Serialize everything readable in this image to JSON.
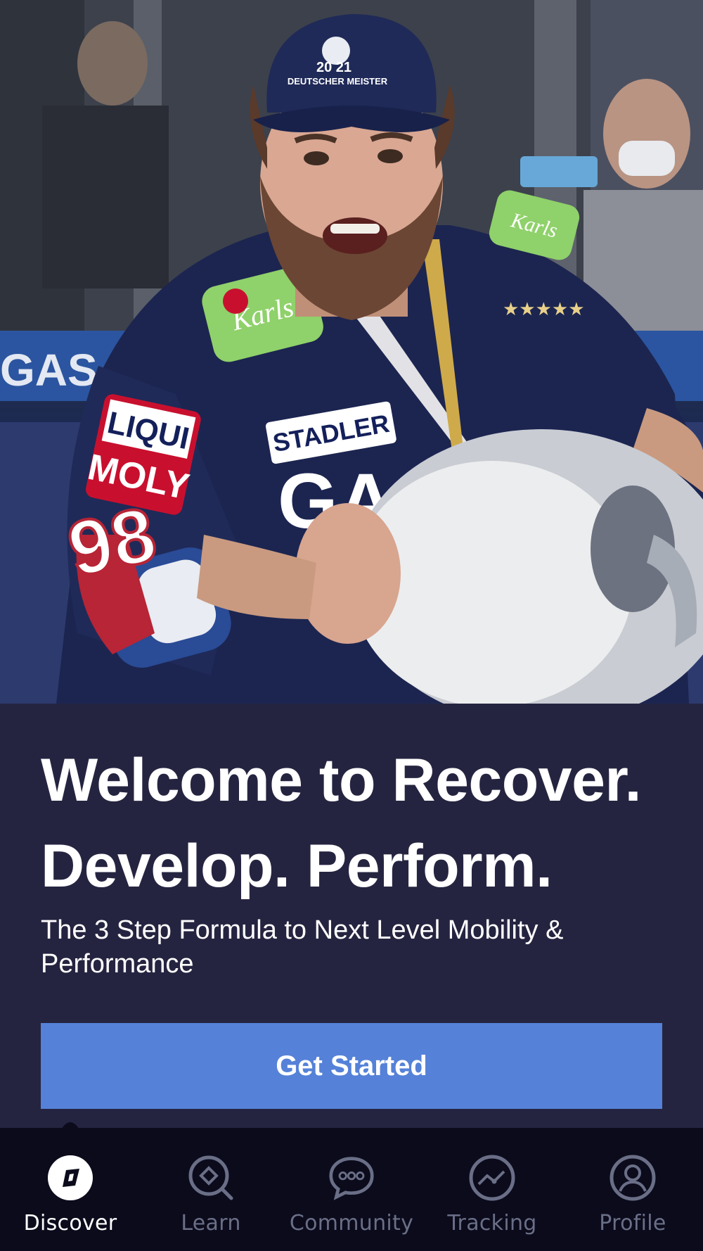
{
  "hero": {
    "image_alt": "Hockey player celebrating with trophy",
    "cap_text": "DEUTSCHER MEISTER",
    "cap_year": "20 21",
    "sponsor_1": "LIQUI MOLY",
    "sponsor_2": "STADLER",
    "jersey_number": "98",
    "board_text": "GAS"
  },
  "welcome": {
    "headline_line1": "Welcome to Recover.",
    "headline_line2": "Develop. Perform.",
    "subheadline": "The 3 Step Formula to Next Level Mobility & Performance",
    "cta_label": "Get Started"
  },
  "tabbar": {
    "items": [
      {
        "label": "Discover",
        "icon": "compass-icon",
        "active": true
      },
      {
        "label": "Learn",
        "icon": "search-diamond-icon",
        "active": false
      },
      {
        "label": "Community",
        "icon": "chat-bubble-icon",
        "active": false
      },
      {
        "label": "Tracking",
        "icon": "trend-icon",
        "active": false
      },
      {
        "label": "Profile",
        "icon": "user-icon",
        "active": false
      }
    ]
  },
  "colors": {
    "background": "#252440",
    "accent": "#5582d8",
    "tabbar": "#0b0b1c",
    "inactive_tab": "#6a6f87"
  }
}
